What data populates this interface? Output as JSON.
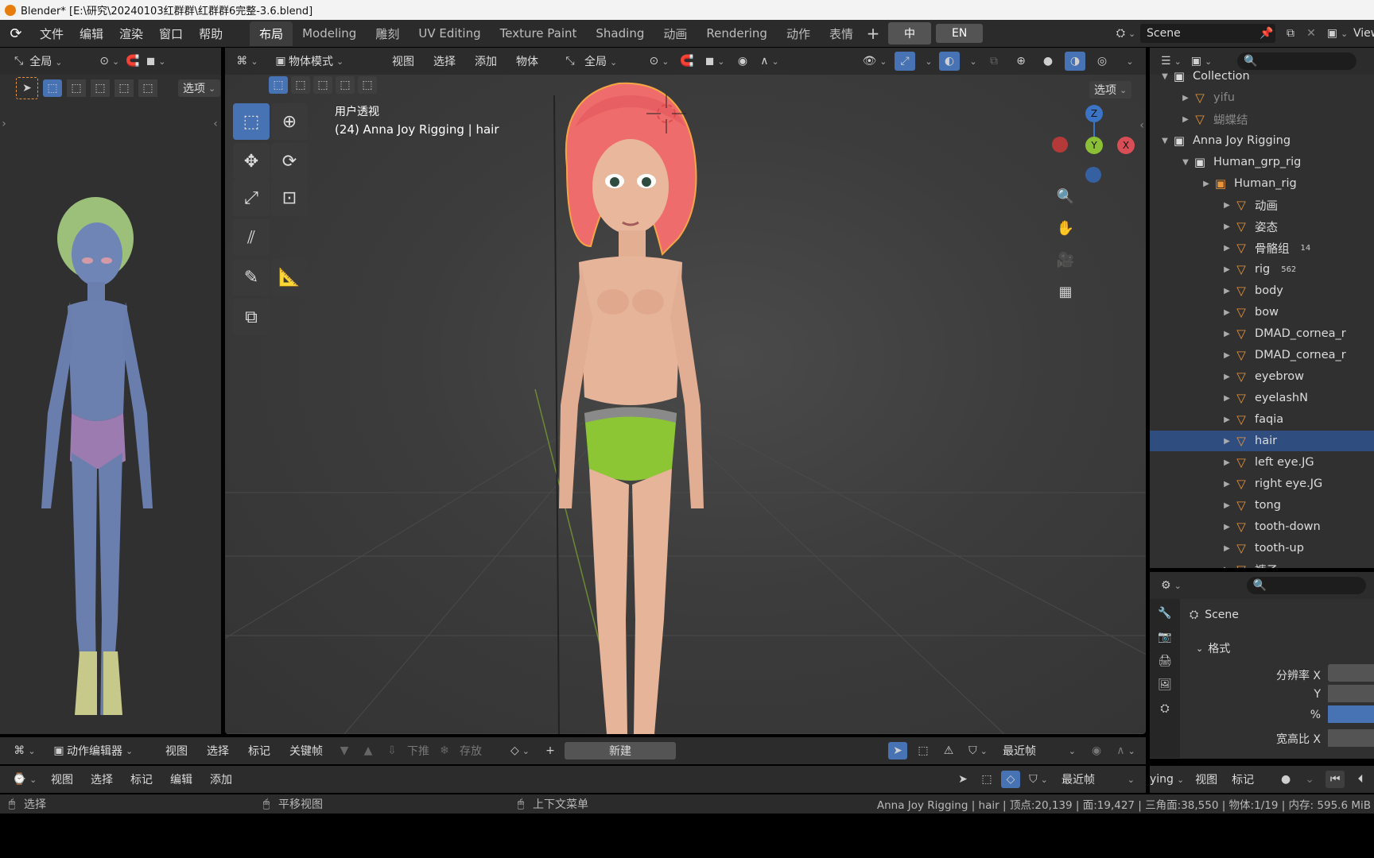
{
  "window_title": "Blender* [E:\\研究\\20240103红群群\\红群群6完整-3.6.blend]",
  "menu": [
    "文件",
    "编辑",
    "渲染",
    "窗口",
    "帮助"
  ],
  "workspaces": [
    "布局",
    "Modeling",
    "雕刻",
    "UV Editing",
    "Texture Paint",
    "Shading",
    "动画",
    "Rendering",
    "动作",
    "表情"
  ],
  "lang_buttons": [
    "中",
    "EN"
  ],
  "scene_name": "Scene",
  "view_label": "View",
  "left_header": {
    "transform": "全局",
    "options": "选项"
  },
  "viewport_header": {
    "mode": "物体模式",
    "menus": [
      "视图",
      "选择",
      "添加",
      "物体"
    ],
    "transform": "全局",
    "options": "选项"
  },
  "viewport_overlay": {
    "view_name": "用户透视",
    "object_info": "(24) Anna Joy Rigging | hair"
  },
  "gizmo": {
    "x": "X",
    "y": "Y",
    "z": "Z"
  },
  "outliner": {
    "rows": [
      {
        "label": "Collection",
        "indent": 0
      },
      {
        "label": "yifu",
        "indent": 1
      },
      {
        "label": "蝴蝶结",
        "indent": 1
      },
      {
        "label": "Anna Joy Rigging",
        "indent": 0
      },
      {
        "label": "Human_grp_rig",
        "indent": 1
      },
      {
        "label": "Human_rig",
        "indent": 2
      },
      {
        "label": "动画",
        "indent": 3
      },
      {
        "label": "姿态",
        "indent": 3
      },
      {
        "label": "骨骼组",
        "indent": 3,
        "badge": "14"
      },
      {
        "label": "rig",
        "indent": 3,
        "badge": "562"
      },
      {
        "label": "body",
        "indent": 3
      },
      {
        "label": "bow",
        "indent": 3
      },
      {
        "label": "DMAD_cornea_r",
        "indent": 3
      },
      {
        "label": "DMAD_cornea_r",
        "indent": 3
      },
      {
        "label": "eyebrow",
        "indent": 3
      },
      {
        "label": "eyelashN",
        "indent": 3
      },
      {
        "label": "faqia",
        "indent": 3
      },
      {
        "label": "hair",
        "indent": 3,
        "selected": true
      },
      {
        "label": "left eye.JG",
        "indent": 3
      },
      {
        "label": "right eye.JG",
        "indent": 3
      },
      {
        "label": "tong",
        "indent": 3
      },
      {
        "label": "tooth-down",
        "indent": 3
      },
      {
        "label": "tooth-up",
        "indent": 3
      },
      {
        "label": "裤子",
        "indent": 3
      }
    ]
  },
  "properties": {
    "scene": "Scene",
    "section": "格式",
    "fields": [
      "分辨率 X",
      "Y",
      "%",
      "宽高比 X"
    ]
  },
  "action_editor": {
    "mode": "动作编辑器",
    "menus": [
      "视图",
      "选择",
      "标记",
      "关键帧"
    ],
    "push_down": "下推",
    "stash": "存放",
    "new": "新建",
    "snap": "最近帧"
  },
  "timeline": {
    "menus": [
      "视图",
      "选择",
      "标记",
      "编辑",
      "添加"
    ],
    "snap": "最近帧",
    "playback": "ying",
    "menus_right": [
      "视图",
      "标记"
    ]
  },
  "statusbar": {
    "select": "选择",
    "pan": "平移视图",
    "context_menu": "上下文菜单",
    "stats": "Anna Joy Rigging | hair | 顶点:20,139 | 面:19,427 | 三角面:38,550 | 物体:1/19 | 内存: 595.6 MiB"
  },
  "colors": {
    "selected_blue": "#4772b3",
    "mesh_orange": "#e8953a",
    "bg": "#303030"
  }
}
